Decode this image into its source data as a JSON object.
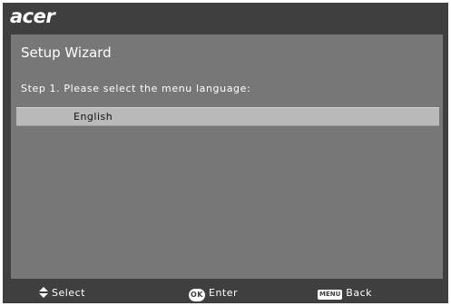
{
  "brand": {
    "logo_text": "acer"
  },
  "wizard": {
    "title": "Setup Wizard",
    "prompt": "Step 1. Please select the menu language:",
    "options": [
      {
        "label": "English",
        "selected": true
      }
    ]
  },
  "footer": {
    "select_label": "Select",
    "enter_label": "Enter",
    "ok_badge": "OK",
    "back_label": "Back",
    "menu_badge": "MENU"
  },
  "icons": {
    "select": "up-down-arrows-icon",
    "enter": "ok-button-icon",
    "back": "menu-button-icon"
  },
  "colors": {
    "background": "#3f3f3f",
    "panel": "#777777",
    "highlight": "#b9b9b9",
    "text": "#ffffff"
  }
}
